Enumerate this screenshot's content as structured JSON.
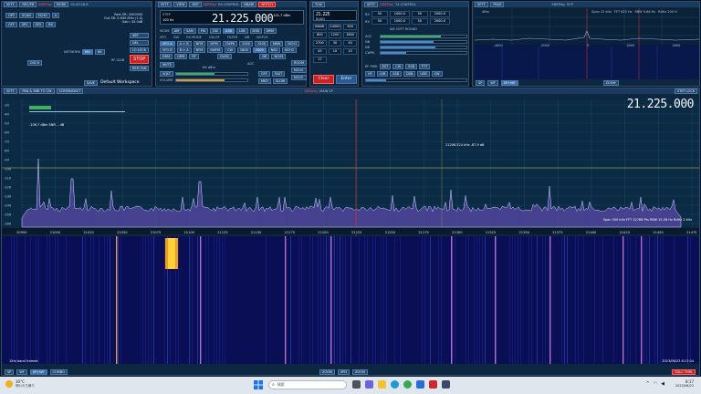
{
  "left_panel": {
    "menu": [
      "SETT.",
      "REC/PB",
      "SDRPlay",
      "MODE",
      "01:43:18.6"
    ],
    "row1": [
      "OPT",
      "SCAN",
      "ECHO",
      "A"
    ],
    "row2": [
      "OFF",
      "SPC",
      "SP2",
      "RX"
    ],
    "info": [
      "Real SR: 2000000",
      "Out SR: 0.600 MHz (1.0)",
      "Gain: 45.0dB"
    ],
    "labels": [
      "NETWORK",
      "RF GAIN"
    ],
    "buttons": [
      "MH",
      "HK",
      "SBT",
      "DEL",
      "LO LOCK",
      "STOP",
      "REM FAN"
    ],
    "bottom": [
      "SAVE",
      "Default Workspace",
      "DIG R"
    ]
  },
  "rx_control": {
    "menu": [
      "SETT.",
      "VIEW",
      "DSP",
      "SDRPlay",
      "RX CONTROL",
      "NB/NR",
      "NOTCH"
    ],
    "step_label": "STEP",
    "step_value": "100 Hz",
    "frequency": "21.225.000",
    "level": "-101.7 dBm",
    "mode_label": "MODE",
    "modes": [
      "AM",
      "SAM",
      "FM",
      "CW",
      "USB",
      "LSB",
      "DSB",
      "DRM"
    ],
    "vfo_labels": [
      "VFO",
      "DIV",
      "RX MODE",
      "CW-OF",
      "FILTER",
      "NB",
      "NOTCH"
    ],
    "buttons_row1": [
      "VFO A",
      "A > B",
      "NFM",
      "WFM",
      "CWPK",
      "1000",
      "1500",
      "NBW",
      "NCH1"
    ],
    "buttons_row2": [
      "VFO B",
      "B > A",
      "NFM",
      "SWFM",
      "CW",
      "1800",
      "2000",
      "NB2",
      "NCH2"
    ],
    "buttons_row3": [
      "DRM",
      "QRM",
      "RF",
      "",
      "CWSC",
      "",
      "",
      "NR",
      "NCH3"
    ],
    "auto": [
      "MUTE",
      "AGC"
    ],
    "slider_labels": [
      "SQLT",
      "VOLUME",
      "-84 dBm"
    ],
    "agc": [
      "OFF",
      "FAST",
      "MED",
      "SLOW"
    ],
    "right_buttons": [
      "ROOM",
      "NCH4",
      "NCH5"
    ]
  },
  "tcw": {
    "menu": [
      "TCW",
      "",
      ""
    ],
    "keys": [
      "21.225",
      "BAND",
      "14000",
      "500",
      "800",
      "1200",
      "1800",
      "2700",
      "30",
      "40",
      "45",
      "10",
      "15",
      "17"
    ],
    "display_lines": [
      "BAND",
      "BAND"
    ],
    "clear": "Clear",
    "enter": "Enter"
  },
  "tx_control": {
    "menu": [
      "SETT.",
      "SDRPlay",
      "TX CONTROL"
    ],
    "rows": [
      {
        "label": "RX",
        "cells": [
          "50",
          "1000.0",
          "50",
          "2000.0"
        ]
      },
      {
        "label": "RX",
        "cells": [
          "50",
          "1000.0",
          "50",
          "2000.0"
        ]
      }
    ],
    "sub_label": "AM SOFT ROUND",
    "meters": [
      "AGC",
      "NB",
      "NR",
      "CWPK",
      "RF PWR"
    ],
    "buttons": [
      "EXT",
      "CW",
      "SSB",
      "PTT",
      "ON",
      "OFF"
    ],
    "modes": [
      "HF",
      "LSB",
      "SSB",
      "DSB",
      "USB",
      "CW",
      "MODE",
      "DSB"
    ]
  },
  "spectrum_small": {
    "menu": [
      "SETT.",
      "PEAK",
      "SDRPlay",
      "SCP"
    ],
    "info": [
      "Span 12 kHz",
      "FFT 625 Hz",
      "RBW 9.66 Hz",
      "RdHz 200 H"
    ],
    "axis": [
      "-4000",
      "-2000",
      "0",
      "2000",
      "4000"
    ],
    "db_label": "dBm",
    "bottom": [
      "SP",
      "WF",
      "SP+WF",
      "ZOOM"
    ]
  },
  "main": {
    "menu": [
      "SETT.",
      "PAN & SNR TO CW",
      "SCREENSHOT",
      "SDRplay",
      "MAIN SP"
    ],
    "step_lock": "STEP LOCK",
    "frequency": "21.225.000",
    "level_label": "-106.7 dBm  SNR  -- dB",
    "marker": "21208.524 kHz  -67.9 dB",
    "db_axis": [
      "-30",
      "-40",
      "-50",
      "-60",
      "-70",
      "-80",
      "-90",
      "-100",
      "-110",
      "-120",
      "-130",
      "-140",
      "-150",
      "-160"
    ],
    "freq_axis": [
      "20950",
      "21000",
      "21025",
      "21050",
      "21075",
      "21100",
      "21125",
      "21150",
      "21175",
      "21200",
      "21225",
      "21250",
      "21275",
      "21300",
      "21325",
      "21350",
      "21375",
      "21400",
      "21425",
      "21450",
      "21475"
    ],
    "span_info": "Span 500 kHz   FFT 32768 Pts   RBW 15.26 Hz   RdHz 2 kHz",
    "waterfall_label": "15m band framed",
    "timestamp": "2023/06/23  8:17:04",
    "bottom_left": [
      "SP",
      "WF",
      "SP+WF",
      "COMBO"
    ],
    "bottom_mid": [
      "ZOOM",
      "SPD",
      "ZOOM"
    ],
    "bottom_right": [
      "SQLC THRL",
      "",
      ""
    ]
  },
  "taskbar": {
    "weather": "30°C",
    "weather_sub": "晴れのち曇り",
    "search": "検索",
    "time": "8:17",
    "date": "2023/06/23"
  }
}
